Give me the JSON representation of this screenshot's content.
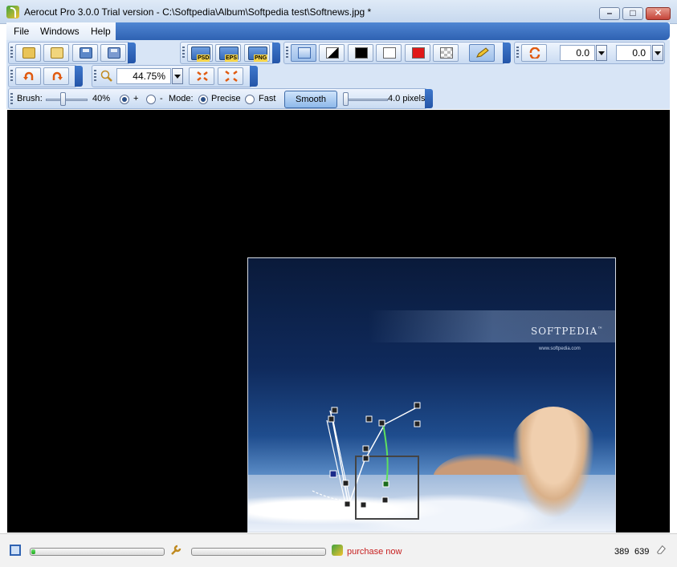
{
  "window": {
    "title": "Aerocut Pro 3.0.0 Trial version - C:\\Softpedia\\Album\\Softpedia test\\Softnews.jpg *",
    "minimize_icon": "minimize-icon",
    "maximize_icon": "maximize-icon",
    "close_icon": "close-icon"
  },
  "menu": {
    "file": "File",
    "windows": "Windows",
    "help": "Help"
  },
  "toolbar_file": {
    "icons": [
      "open-folder-icon",
      "open-recent-icon",
      "save-icon",
      "save-as-icon"
    ]
  },
  "toolbar_export": {
    "psd": "PSD",
    "eps": "EPS",
    "png": "PNG"
  },
  "toolbar_view": {
    "icons": [
      "display-mode-icon",
      "contrast-icon",
      "black-background-icon",
      "white-background-icon",
      "red-background-icon",
      "transparency-grid-icon",
      "pencil-icon"
    ],
    "colors": {
      "black": "#000000",
      "white": "#ffffff",
      "red": "#e01818"
    }
  },
  "toolbar_rotate": {
    "value_1": "0.0",
    "value_2": "0.0"
  },
  "toolbar_history": {
    "icons": [
      "undo-icon",
      "redo-icon"
    ]
  },
  "toolbar_zoom": {
    "zoom_value": "44.75%",
    "icons": [
      "zoom-icon",
      "fit-in-icon",
      "fit-out-icon"
    ]
  },
  "toolbar_brush": {
    "brush_label": "Brush:",
    "brush_value": "40%",
    "plus_label": "+",
    "minus_label": "-",
    "mode_label": "Mode:",
    "precise_label": "Precise",
    "fast_label": "Fast",
    "smooth_label": "Smooth",
    "pixels_value": "4.0 pixels"
  },
  "image": {
    "brand": "SOFTPEDIA",
    "trademark": "™",
    "url": "www.softpedia.com"
  },
  "statusbar": {
    "purchase": "purchase now",
    "coord_x": "389",
    "coord_y": "639",
    "progress_1": 0.03,
    "progress_2": 0.0
  }
}
